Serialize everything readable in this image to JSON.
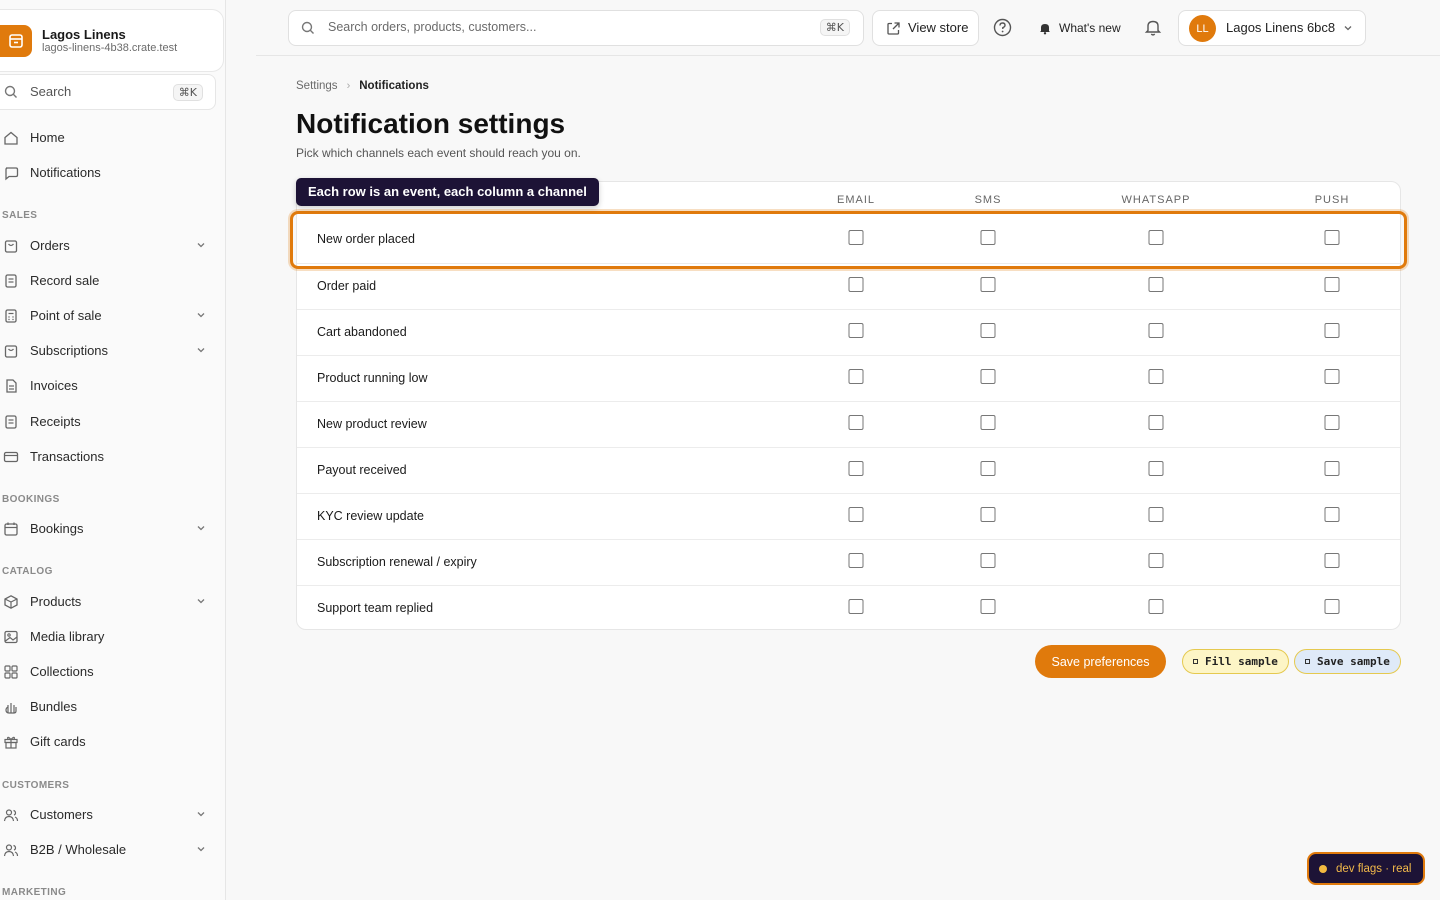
{
  "brand": {
    "name": "Lagos Linens",
    "domain": "lagos-linens-4b38.crate.test",
    "color": "#e07a0c"
  },
  "sidebar": {
    "search_label": "Search",
    "search_kbd": "⌘K",
    "home": "Home",
    "notifications": "Notifications",
    "sections": {
      "sales": "SALES",
      "bookings": "BOOKINGS",
      "catalog": "CATALOG",
      "customers": "CUSTOMERS",
      "marketing": "MARKETING"
    },
    "items": {
      "orders": "Orders",
      "record_sale": "Record sale",
      "point_of_sale": "Point of sale",
      "subscriptions": "Subscriptions",
      "invoices": "Invoices",
      "receipts": "Receipts",
      "transactions": "Transactions",
      "bookings": "Bookings",
      "products": "Products",
      "media_library": "Media library",
      "collections": "Collections",
      "bundles": "Bundles",
      "gift_cards": "Gift cards",
      "customers": "Customers",
      "b2b": "B2B / Wholesale"
    }
  },
  "topbar": {
    "search_placeholder": "Search orders, products, customers...",
    "search_kbd": "⌘K",
    "view_store": "View store",
    "whats_new": "What's new",
    "account_initials": "LL",
    "account_name": "Lagos Linens 6bc8"
  },
  "breadcrumb": {
    "parent": "Settings",
    "current": "Notifications"
  },
  "page": {
    "title": "Notification settings",
    "subtitle": "Pick which channels each event should reach you on."
  },
  "tooltip": "Each row is an event, each column a channel",
  "table": {
    "columns": [
      "EMAIL",
      "SMS",
      "WHATSAPP",
      "PUSH"
    ],
    "rows": [
      {
        "event": "New order placed",
        "checked": [
          false,
          false,
          false,
          false
        ]
      },
      {
        "event": "Order paid",
        "checked": [
          false,
          false,
          false,
          false
        ]
      },
      {
        "event": "Cart abandoned",
        "checked": [
          false,
          false,
          false,
          false
        ]
      },
      {
        "event": "Product running low",
        "checked": [
          false,
          false,
          false,
          false
        ]
      },
      {
        "event": "New product review",
        "checked": [
          false,
          false,
          false,
          false
        ]
      },
      {
        "event": "Payout received",
        "checked": [
          false,
          false,
          false,
          false
        ]
      },
      {
        "event": "KYC review update",
        "checked": [
          false,
          false,
          false,
          false
        ]
      },
      {
        "event": "Subscription renewal / expiry",
        "checked": [
          false,
          false,
          false,
          false
        ]
      },
      {
        "event": "Support team replied",
        "checked": [
          false,
          false,
          false,
          false
        ]
      }
    ]
  },
  "actions": {
    "save": "Save preferences",
    "fill_sample": "Fill sample",
    "save_sample": "Save sample"
  },
  "dev_flags": "dev flags · real"
}
